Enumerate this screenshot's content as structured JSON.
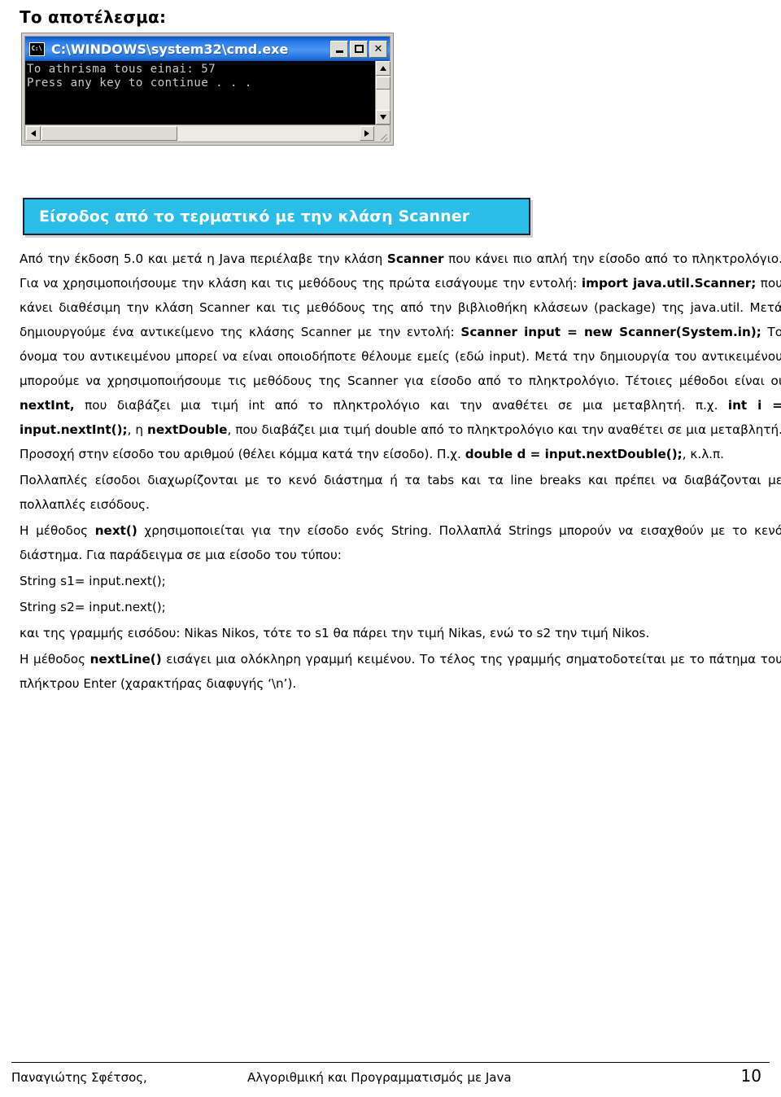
{
  "heading": "Το αποτέλεσμα:",
  "cmd_window": {
    "icon_label": "C:\\",
    "title": "C:\\WINDOWS\\system32\\cmd.exe",
    "minimize_label": "_",
    "maximize_label": "□",
    "close_label": "✕",
    "console_lines": [
      "To athrisma tous einai: 57",
      "Press any key to continue . . ."
    ],
    "scroll_up_label": "▲",
    "scroll_down_label": "▼",
    "scroll_left_label": "◄",
    "scroll_right_label": "►"
  },
  "banner": {
    "title": "Είσοδος από το τερματικό με την κλάση Scanner",
    "background_color": "#29BDE8",
    "text_color": "#FFFFFF",
    "border_color": "#1F2430"
  },
  "paragraphs": [
    {
      "id": "p1",
      "align": "justify",
      "runs": [
        {
          "text": "Από την έκδοση 5.0 και μετά η Java περιέλαβε την κλάση ",
          "bold": false
        },
        {
          "text": "Scanner",
          "bold": true
        },
        {
          "text": " που κάνει πιο απλή την είσοδο από το πληκτρολόγιο. Για να χρησιμοποιήσουμε την κλάση και τις μεθόδους της πρώτα εισάγουμε την εντολή: ",
          "bold": false
        },
        {
          "text": "import java.util.Scanner;",
          "bold": true
        },
        {
          "text": " που κάνει διαθέσιμη την κλάση Scanner και τις μεθόδους της από την βιβλιοθήκη κλάσεων (package) της java.util. Μετά δημιουργούμε ένα αντικείμενο της κλάσης Scanner με την εντολή: ",
          "bold": false
        },
        {
          "text": "Scanner input = new Scanner(System.in);",
          "bold": true
        },
        {
          "text": " Το όνομα του αντικειμένου μπορεί να είναι οποιοδήποτε θέλουμε εμείς (εδώ input). Μετά την δημιουργία του αντικειμένου μπορούμε να χρησιμοποιήσουμε τις μεθόδους της Scanner για είσοδο από το πληκτρολόγιο. Τέτοιες μέθοδοι είναι οι ",
          "bold": false
        },
        {
          "text": "nextInt,",
          "bold": true
        },
        {
          "text": " που διαβάζει μια τιμή int από το πληκτρολόγιο και την αναθέτει σε μια μεταβλητή. π.χ. ",
          "bold": false
        },
        {
          "text": "int i = input.nextInt();",
          "bold": true
        },
        {
          "text": ", η ",
          "bold": false
        },
        {
          "text": "nextDouble",
          "bold": true
        },
        {
          "text": ", που διαβάζει μια τιμή double από το πληκτρολόγιο και την αναθέτει σε μια μεταβλητή. Προσοχή στην είσοδο του αριθμού (θέλει κόμμα κατά την είσοδο). Π.χ. ",
          "bold": false
        },
        {
          "text": "double d = input.nextDouble();",
          "bold": true
        },
        {
          "text": ", κ.λ.π.",
          "bold": false
        }
      ]
    },
    {
      "id": "p2",
      "align": "justify",
      "runs": [
        {
          "text": "Πολλαπλές είσοδοι διαχωρίζονται με το κενό διάστημα ή τα tabs και τα line breaks και πρέπει να διαβάζονται με πολλαπλές εισόδους.",
          "bold": false
        }
      ]
    },
    {
      "id": "p3",
      "align": "justify",
      "runs": [
        {
          "text": "Η μέθοδος ",
          "bold": false
        },
        {
          "text": "next()",
          "bold": true
        },
        {
          "text": " χρησιμοποιείται για την είσοδο ενός String. Πολλαπλά Strings μπορούν να εισαχθούν με το κενό διάστημα. Για παράδειγμα σε μια είσοδο του τύπου:",
          "bold": false
        }
      ]
    },
    {
      "id": "p4",
      "align": "left",
      "runs": [
        {
          "text": "String s1= input.next();",
          "bold": false
        }
      ]
    },
    {
      "id": "p5",
      "align": "left",
      "runs": [
        {
          "text": "String s2= input.next();",
          "bold": false
        }
      ]
    },
    {
      "id": "p6",
      "align": "justify",
      "runs": [
        {
          "text": "και της γραμμής εισόδου: Nikas Nikos, τότε το s1 θα πάρει την τιμή Nikas, ενώ το s2 την τιμή Nikos.",
          "bold": false
        }
      ]
    },
    {
      "id": "p7",
      "align": "justify",
      "runs": [
        {
          "text": "Η μέθοδος ",
          "bold": false
        },
        {
          "text": "nextLine()",
          "bold": true
        },
        {
          "text": " εισάγει μια ολόκληρη γραμμή κειμένου. Το τέλος της γραμμής σηματοδοτείται με το πάτημα του πλήκτρου Enter (χαρακτήρας διαφυγής ‘\\n’).",
          "bold": false
        }
      ]
    }
  ],
  "footer": {
    "author": "Παναγιώτης Σφέτσος,",
    "book_title": "Αλγοριθμική και Προγραμματισμός με Java",
    "page_number": "10"
  }
}
